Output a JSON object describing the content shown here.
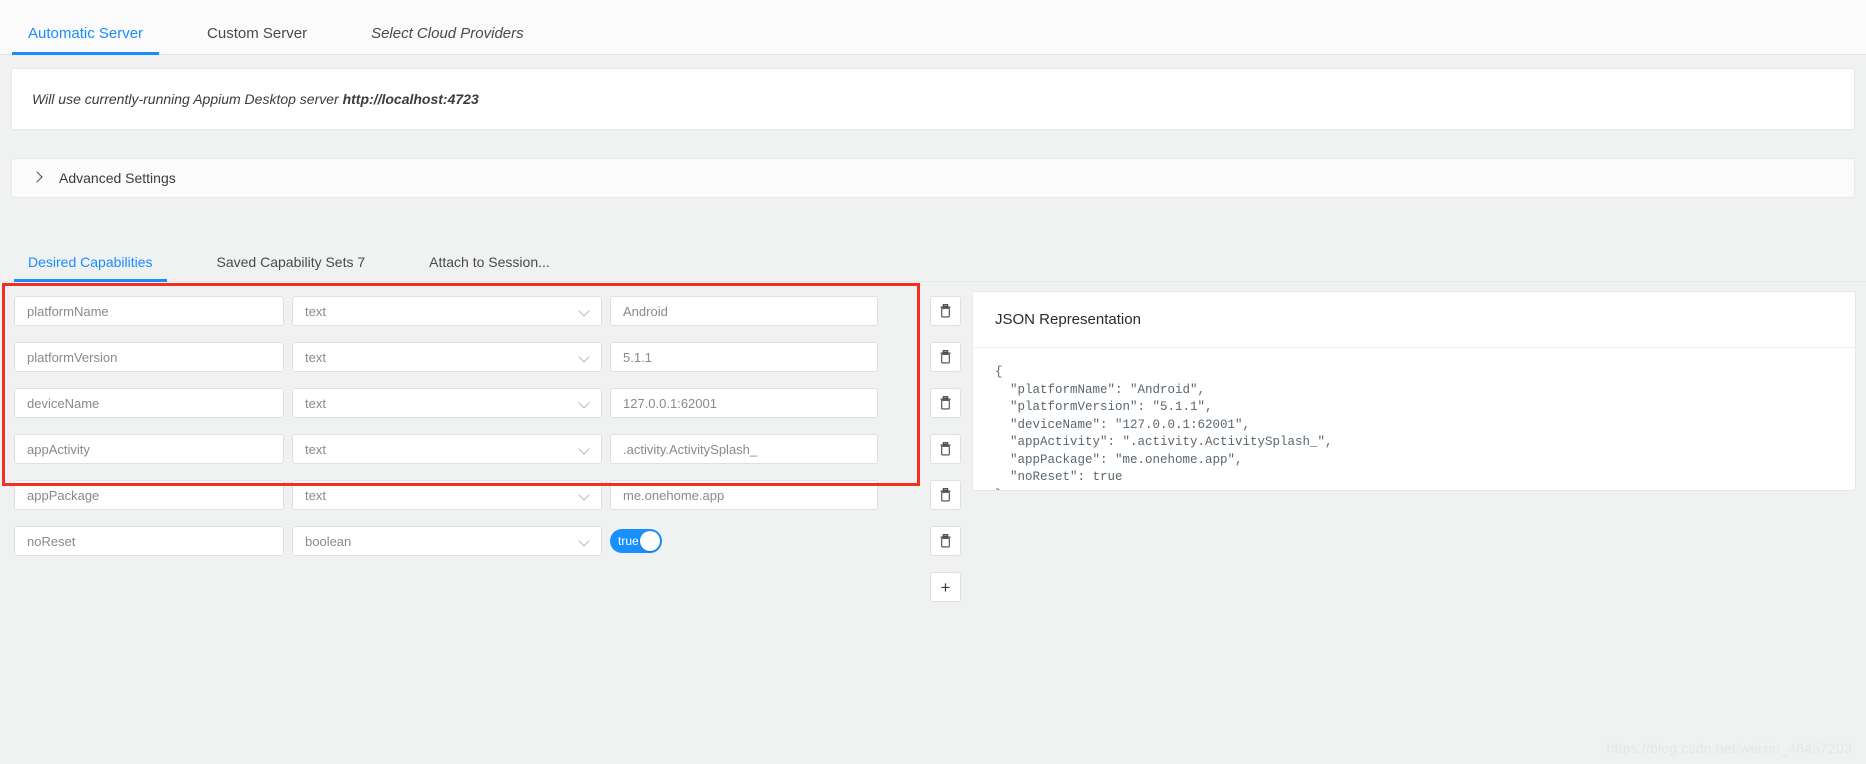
{
  "server_tabs": [
    {
      "label": "Automatic Server",
      "active": true,
      "italic": false
    },
    {
      "label": "Custom Server",
      "active": false,
      "italic": false
    },
    {
      "label": "Select Cloud Providers",
      "active": false,
      "italic": true
    }
  ],
  "server_info": {
    "text": "Will use currently-running Appium Desktop server ",
    "url": "http://localhost:4723"
  },
  "advanced_settings": {
    "label": "Advanced Settings",
    "chevron": "chevron-right-icon",
    "expanded": false
  },
  "capability_tabs": [
    {
      "label": "Desired Capabilities",
      "active": true
    },
    {
      "label": "Saved Capability Sets 7",
      "active": false
    },
    {
      "label": "Attach to Session...",
      "active": false
    }
  ],
  "capabilities": [
    {
      "name": "platformName",
      "type": "text",
      "value": "Android",
      "control": "input"
    },
    {
      "name": "platformVersion",
      "type": "text",
      "value": "5.1.1",
      "control": "input"
    },
    {
      "name": "deviceName",
      "type": "text",
      "value": "127.0.0.1:62001",
      "control": "input"
    },
    {
      "name": "appActivity",
      "type": "text",
      "value": ".activity.ActivitySplash_",
      "control": "input"
    },
    {
      "name": "appPackage",
      "type": "text",
      "value": "me.onehome.app",
      "control": "input"
    },
    {
      "name": "noReset",
      "type": "boolean",
      "value": "true",
      "control": "toggle"
    }
  ],
  "row_actions": {
    "delete_icon": "trash-icon",
    "add_label": "+"
  },
  "json_panel": {
    "title": "JSON Representation",
    "content": "{\n  \"platformName\": \"Android\",\n  \"platformVersion\": \"5.1.1\",\n  \"deviceName\": \"127.0.0.1:62001\",\n  \"appActivity\": \".activity.ActivitySplash_\",\n  \"appPackage\": \"me.onehome.app\",\n  \"noReset\": true\n}"
  },
  "annotation": {
    "highlight_color": "#ef3124"
  },
  "watermark": "https://blog.csdn.net/weixin_46457203",
  "colors": {
    "accent": "#1a8cff",
    "toggle_on": "#1890ff",
    "annotation": "#ef3124"
  }
}
